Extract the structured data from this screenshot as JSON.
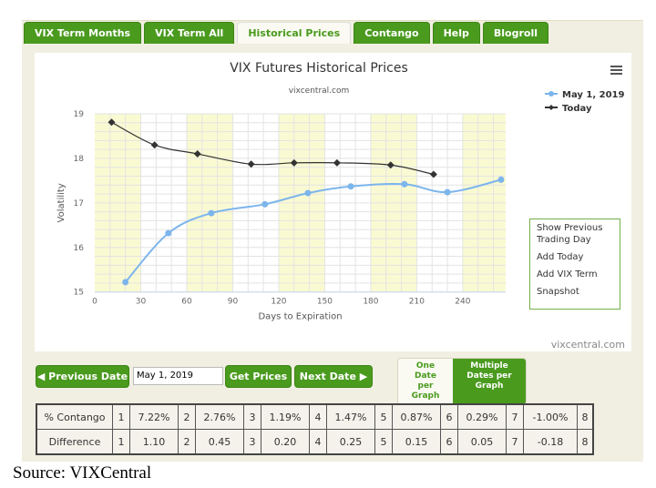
{
  "tabs": [
    "VIX Term Months",
    "VIX Term All",
    "Historical Prices",
    "Contango",
    "Help",
    "Blogroll"
  ],
  "active_tab": 2,
  "chart_data": {
    "type": "line",
    "title": "VIX Futures Historical Prices",
    "subtitle": "vixcentral.com",
    "credit": "vixcentral.com",
    "xlabel": "Days to Expiration",
    "ylabel": "Volatility",
    "xlim": [
      0,
      268
    ],
    "ylim": [
      15,
      19
    ],
    "xticks": [
      0,
      30,
      60,
      90,
      120,
      150,
      180,
      210,
      240
    ],
    "yticks": [
      15,
      16,
      17,
      18,
      19
    ],
    "grid": true,
    "legend": "top-right",
    "shaded_bands": [
      [
        0,
        30
      ],
      [
        60,
        90
      ],
      [
        120,
        150
      ],
      [
        180,
        210
      ],
      [
        240,
        268
      ]
    ],
    "series": [
      {
        "name": "May 1, 2019",
        "color": "#7cb5ec",
        "marker": "circle",
        "x": [
          20,
          48,
          76,
          111,
          139,
          167,
          202,
          230,
          265
        ],
        "y": [
          15.22,
          16.32,
          16.77,
          16.97,
          17.22,
          17.37,
          17.42,
          17.24,
          17.52
        ]
      },
      {
        "name": "Today",
        "color": "#333333",
        "marker": "diamond",
        "x": [
          11,
          39,
          67,
          102,
          130,
          158,
          193,
          221
        ],
        "y": [
          18.81,
          18.3,
          18.1,
          17.87,
          17.9,
          17.9,
          17.85,
          17.64
        ]
      }
    ]
  },
  "menu_icon": "hamburger-icon",
  "context_menu": [
    "Show Previous Trading Day",
    "Add Today",
    "Add VIX Term",
    "Snapshot"
  ],
  "controls": {
    "prev": "Previous Date",
    "date": "May 1, 2019",
    "get": "Get Prices",
    "next": "Next Date",
    "one": "One Date per Graph",
    "multi": "Multiple Dates per Graph"
  },
  "table": {
    "rows": [
      {
        "label": "% Contango",
        "values": [
          "7.22%",
          "2.76%",
          "1.19%",
          "1.47%",
          "0.87%",
          "0.29%",
          "-1.00%"
        ]
      },
      {
        "label": "Difference",
        "values": [
          "1.10",
          "0.45",
          "0.20",
          "0.25",
          "0.15",
          "0.05",
          "-0.18"
        ]
      }
    ],
    "indices": [
      "1",
      "2",
      "3",
      "4",
      "5",
      "6",
      "7",
      "8"
    ]
  },
  "source": "Source: VIXCentral"
}
